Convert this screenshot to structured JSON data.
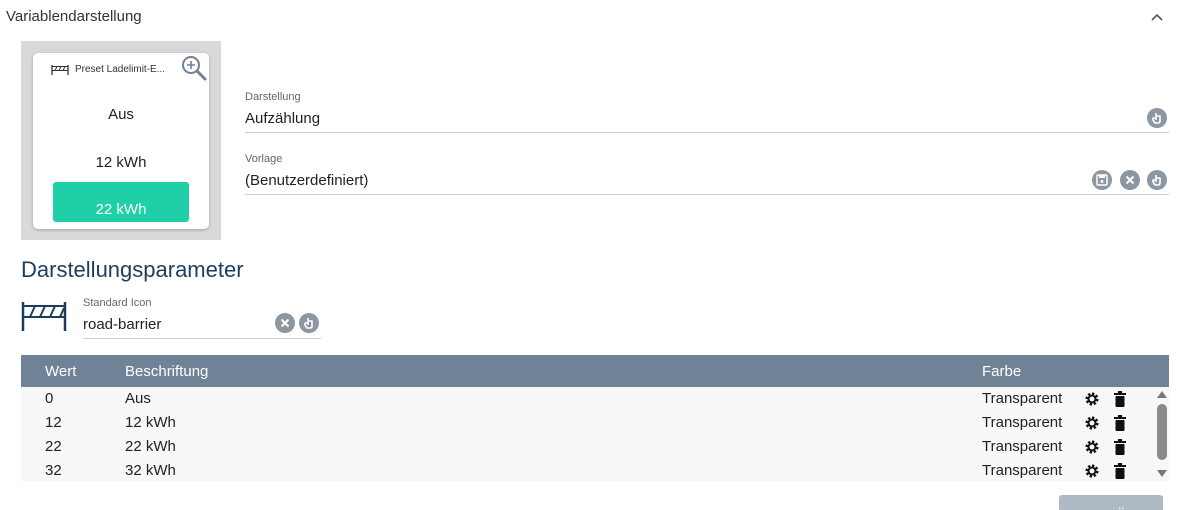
{
  "section": {
    "title": "Variablendarstellung"
  },
  "preview": {
    "title": "Preset Ladelimit-E...",
    "options": [
      "Aus",
      "12 kWh",
      "22 kWh"
    ],
    "active_color": "#1fcfa7"
  },
  "darstellung": {
    "label": "Darstellung",
    "value": "Aufzählung"
  },
  "vorlage": {
    "label": "Vorlage",
    "value": "(Benutzerdefiniert)"
  },
  "params": {
    "title": "Darstellungsparameter"
  },
  "standard_icon": {
    "label": "Standard Icon",
    "value": "road-barrier"
  },
  "table": {
    "headers": {
      "wert": "Wert",
      "beschriftung": "Beschriftung",
      "farbe": "Farbe"
    },
    "rows": [
      {
        "wert": "0",
        "beschriftung": "Aus",
        "farbe": "Transparent"
      },
      {
        "wert": "12",
        "beschriftung": "12 kWh",
        "farbe": "Transparent"
      },
      {
        "wert": "22",
        "beschriftung": "22 kWh",
        "farbe": "Transparent"
      },
      {
        "wert": "32",
        "beschriftung": "32 kWh",
        "farbe": "Transparent"
      }
    ]
  },
  "add_button": {
    "label": "HINZUFÜGEN"
  },
  "colors": {
    "header_bg": "#6f8296",
    "title": "#1d3d5c",
    "icon_gray": "#8c97a1"
  }
}
